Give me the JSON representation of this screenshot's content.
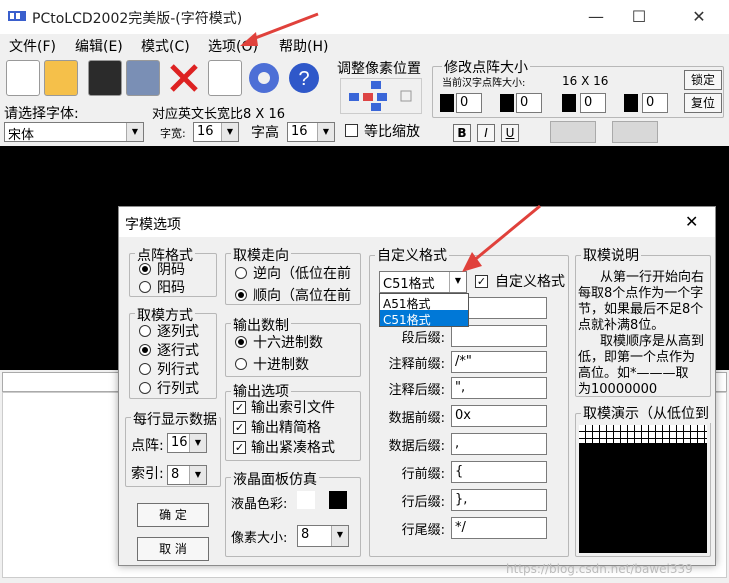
{
  "window": {
    "title": "PCtoLCD2002完美版-(字符模式)",
    "minimize": "—",
    "maximize": "☐",
    "close": "✕"
  },
  "menu": [
    "文件(F)",
    "编辑(E)",
    "模式(C)",
    "选项(O)",
    "帮助(H)"
  ],
  "toolbar": {
    "adjust_label": "调整像素位置",
    "resize_label": "修改点阵大小",
    "current_size_label": "当前汉字点阵大小:",
    "current_size_value": "16  X  16",
    "lock_button": "锁定",
    "reset_button": "复位",
    "spin_values": [
      "0",
      "0",
      "0",
      "0"
    ],
    "font_prompt": "请选择字体:",
    "en_width_label": "对应英文长宽比8 X 16",
    "font_name": "宋体",
    "width_label": "字宽:",
    "width_value": "16",
    "height_label": "字高",
    "height_value": "16",
    "proportional_label": "等比缩放",
    "bold": "B",
    "italic": "I",
    "underline": "U"
  },
  "dialog": {
    "title": "字模选项",
    "close": "✕",
    "dot_format": {
      "title": "点阵格式",
      "options": [
        "阴码",
        "阳码"
      ],
      "selected": 0
    },
    "mode": {
      "title": "取模方式",
      "options": [
        "逐列式",
        "逐行式",
        "列行式",
        "行列式"
      ],
      "selected": 1
    },
    "per_line": {
      "title": "每行显示数据",
      "dot_label": "点阵:",
      "dot_value": "16",
      "index_label": "索引:",
      "index_value": "8"
    },
    "ok": "确    定",
    "cancel": "取    消",
    "direction": {
      "title": "取模走向",
      "options": [
        "逆向（低位在前",
        "顺向（高位在前"
      ],
      "selected": 1
    },
    "number_base": {
      "title": "输出数制",
      "options": [
        "十六进制数",
        "十进制数"
      ],
      "selected": 0
    },
    "output": {
      "title": "输出选项",
      "options": [
        "输出索引文件",
        "输出精简格",
        "输出紧凑格式"
      ]
    },
    "lcd": {
      "title": "液晶面板仿真",
      "color_label": "液晶色彩:",
      "pixel_label": "像素大小:",
      "pixel_value": "8"
    },
    "custom": {
      "title": "自定义格式",
      "format_value": "C51格式",
      "custom_check_label": "自定义格式",
      "dropdown_options": [
        "A51格式",
        "C51格式"
      ],
      "fields": [
        {
          "label": "段后缀:",
          "value": ""
        },
        {
          "label": "注释前缀:",
          "value": "/*\""
        },
        {
          "label": "注释后缀:",
          "value": "\","
        },
        {
          "label": "数据前缀:",
          "value": "0x"
        },
        {
          "label": "数据后缀:",
          "value": ","
        },
        {
          "label": "行前缀:",
          "value": "{"
        },
        {
          "label": "行后缀:",
          "value": "},"
        },
        {
          "label": "行尾缀:",
          "value": "*/"
        }
      ]
    },
    "explain": {
      "title": "取模说明",
      "lines": [
        "从第一行开始向右",
        "每取8个点作为一个字",
        "节，如果最后不足8个",
        "点就补满8位。",
        "取模顺序是从高到",
        "低，即第一个点作为",
        "高位。如*———取",
        "为10000000"
      ]
    },
    "demo_title": "取模演示（从低位到"
  },
  "watermark": "https://blog.csdn.net/bawei339",
  "colors": {
    "arrow": "#e0413b",
    "selection": "#0078d7"
  }
}
